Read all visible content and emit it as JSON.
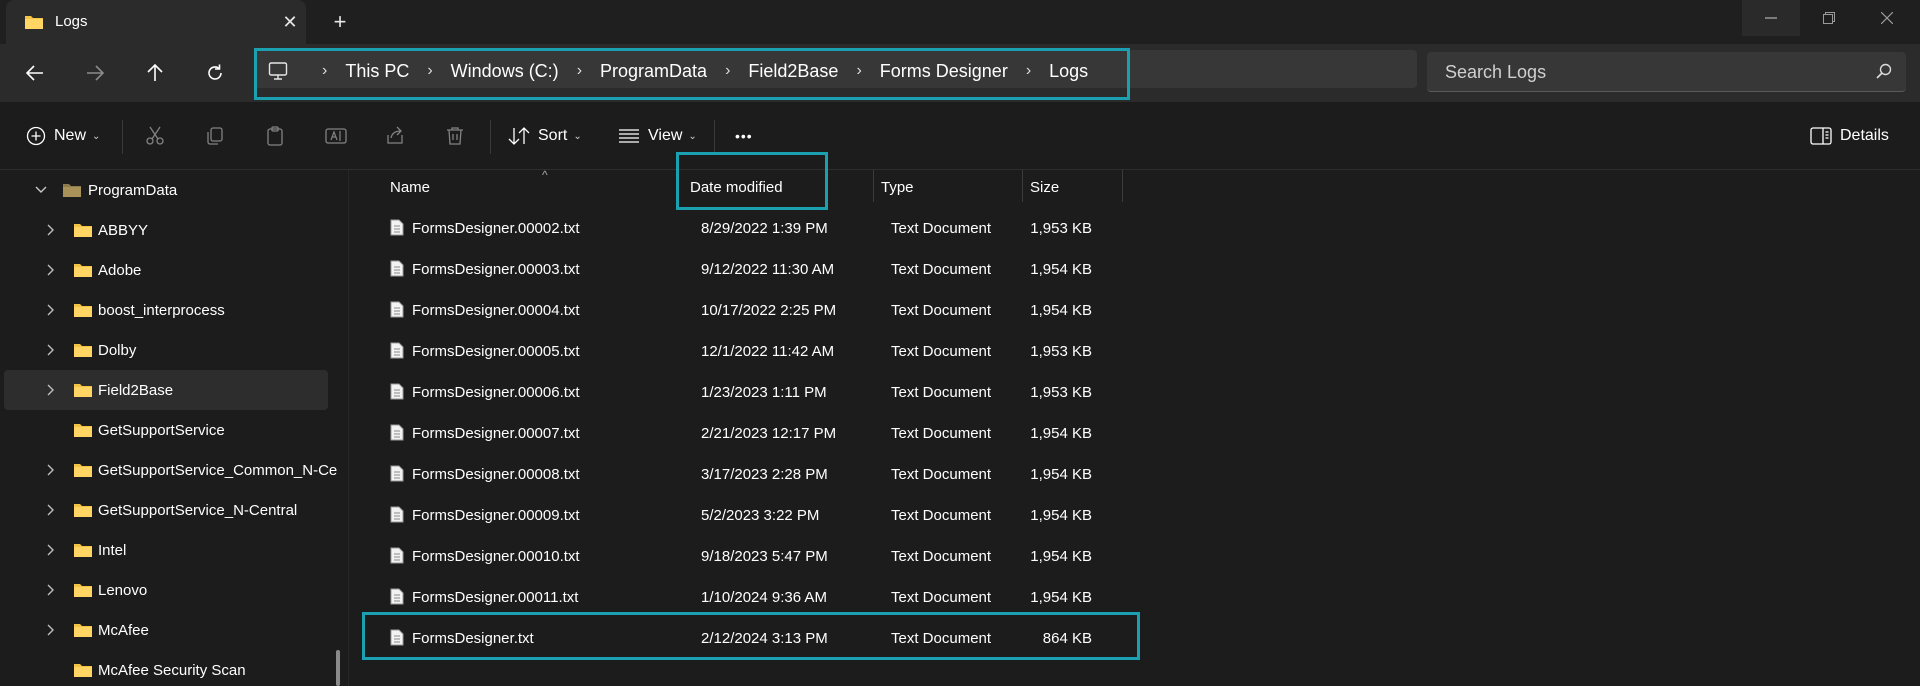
{
  "tab": {
    "title": "Logs",
    "close_glyph": "✕",
    "new_glyph": "+"
  },
  "window_controls": {
    "minimize": "─",
    "maximize": "❐",
    "close": "✕"
  },
  "address": {
    "crumbs": [
      "This PC",
      "Windows (C:)",
      "ProgramData",
      "Field2Base",
      "Forms Designer",
      "Logs"
    ],
    "separator": "›"
  },
  "search": {
    "placeholder": "Search Logs"
  },
  "commands": {
    "new_label": "New",
    "sort_label": "Sort",
    "view_label": "View",
    "more_label": "•••",
    "details_label": "Details",
    "caret": "⌄"
  },
  "sidebar": {
    "items": [
      {
        "label": "ProgramData",
        "expanded": true,
        "has_chevron": true
      },
      {
        "label": "ABBYY",
        "has_chevron": true
      },
      {
        "label": "Adobe",
        "has_chevron": true
      },
      {
        "label": "boost_interprocess",
        "has_chevron": true
      },
      {
        "label": "Dolby",
        "has_chevron": true
      },
      {
        "label": "Field2Base",
        "has_chevron": true,
        "selected": true
      },
      {
        "label": "GetSupportService",
        "has_chevron": false
      },
      {
        "label": "GetSupportService_Common_N-Ce",
        "has_chevron": true
      },
      {
        "label": "GetSupportService_N-Central",
        "has_chevron": true
      },
      {
        "label": "Intel",
        "has_chevron": true
      },
      {
        "label": "Lenovo",
        "has_chevron": true
      },
      {
        "label": "McAfee",
        "has_chevron": true
      },
      {
        "label": "McAfee Security Scan",
        "has_chevron": false
      }
    ]
  },
  "columns": {
    "name": "Name",
    "date": "Date modified",
    "type": "Type",
    "size": "Size",
    "sort_glyph": "^"
  },
  "files": [
    {
      "name": "FormsDesigner.00002.txt",
      "date": "8/29/2022 1:39 PM",
      "type": "Text Document",
      "size": "1,953 KB"
    },
    {
      "name": "FormsDesigner.00003.txt",
      "date": "9/12/2022 11:30 AM",
      "type": "Text Document",
      "size": "1,954 KB"
    },
    {
      "name": "FormsDesigner.00004.txt",
      "date": "10/17/2022 2:25 PM",
      "type": "Text Document",
      "size": "1,954 KB"
    },
    {
      "name": "FormsDesigner.00005.txt",
      "date": "12/1/2022 11:42 AM",
      "type": "Text Document",
      "size": "1,953 KB"
    },
    {
      "name": "FormsDesigner.00006.txt",
      "date": "1/23/2023 1:11 PM",
      "type": "Text Document",
      "size": "1,953 KB"
    },
    {
      "name": "FormsDesigner.00007.txt",
      "date": "2/21/2023 12:17 PM",
      "type": "Text Document",
      "size": "1,954 KB"
    },
    {
      "name": "FormsDesigner.00008.txt",
      "date": "3/17/2023 2:28 PM",
      "type": "Text Document",
      "size": "1,954 KB"
    },
    {
      "name": "FormsDesigner.00009.txt",
      "date": "5/2/2023 3:22 PM",
      "type": "Text Document",
      "size": "1,954 KB"
    },
    {
      "name": "FormsDesigner.00010.txt",
      "date": "9/18/2023 5:47 PM",
      "type": "Text Document",
      "size": "1,954 KB"
    },
    {
      "name": "FormsDesigner.00011.txt",
      "date": "1/10/2024 9:36 AM",
      "type": "Text Document",
      "size": "1,954 KB"
    },
    {
      "name": "FormsDesigner.txt",
      "date": "2/12/2024 3:13 PM",
      "type": "Text Document",
      "size": "864 KB"
    }
  ],
  "colors": {
    "highlight": "#1aa0b0",
    "folder": "#f5c243",
    "background": "#1c1c1c"
  }
}
